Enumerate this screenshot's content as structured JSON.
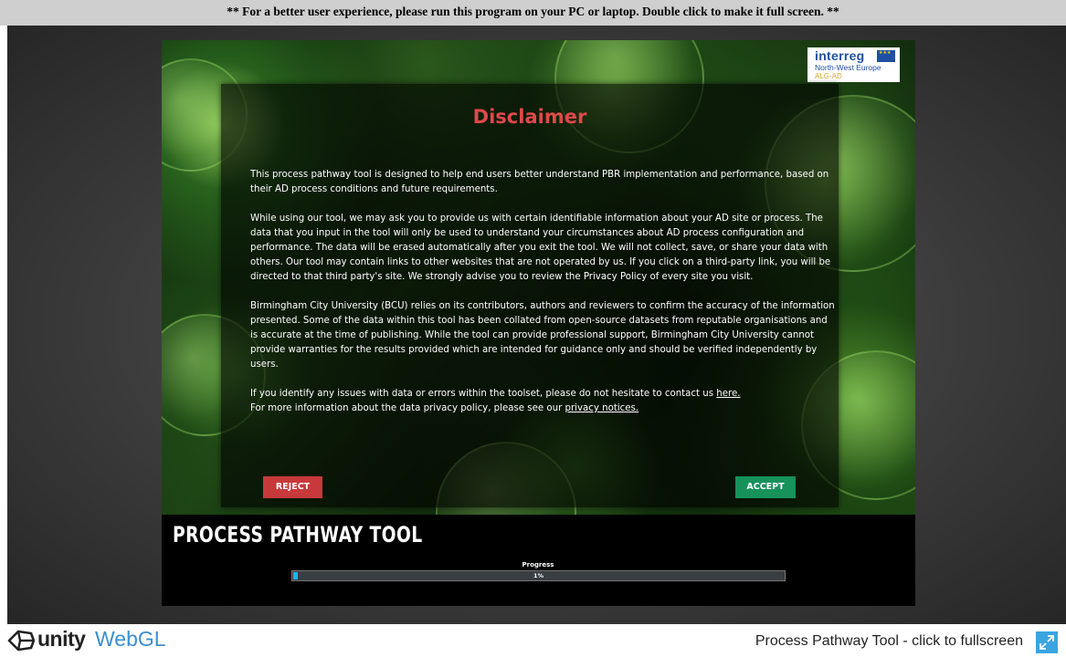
{
  "notice": "** For a better user experience, please run this program on your PC or laptop. Double click to make it full screen. **",
  "logo": {
    "title": "interreg",
    "subtitle": "North-West Europe",
    "project": "ALG-AD",
    "icon": "eu-flag-icon"
  },
  "disclaimer": {
    "title": "Disclaimer",
    "p1": "This process pathway tool is designed to help end users better understand PBR implementation and performance, based on their AD process conditions and future requirements.",
    "p2": "While using our tool, we may ask you to provide us with certain identifiable information about your AD site or process. The data that you input in the tool will only be used to understand your circumstances about AD process configuration and performance. The data will be erased automatically after you exit the tool. We will not collect, save, or share your data with others. Our tool may contain links to other websites that are not operated by us. If you click on a third-party link, you will be directed to that third party's site. We strongly advise you to review the Privacy Policy of every site you visit.",
    "p3": "Birmingham City University (BCU) relies on its contributors, authors and reviewers to confirm the accuracy of the information presented. Some of the data within this tool has been collated from open-source datasets from reputable organisations and is accurate at the time of publishing. While the tool can provide professional support, Birmingham City University cannot provide warranties for the results provided which are intended for guidance only and should be verified independently by users.",
    "contact_prefix": "If you identify any issues with data or errors within the toolset, please do not hesitate to contact us ",
    "contact_link": "here.",
    "privacy_prefix": "For more information about the data privacy policy, please see our ",
    "privacy_link": "privacy notices.",
    "reject_label": "REJECT",
    "accept_label": "ACCEPT"
  },
  "tool": {
    "title": "PROCESS PATHWAY TOOL",
    "progress_label": "Progress",
    "progress_text": "1%",
    "progress_value": 0.01
  },
  "footer": {
    "unity": "unity",
    "webgl": "WebGL",
    "title": "Process Pathway Tool - click to fullscreen",
    "fullscreen_icon": "fullscreen-icon"
  },
  "colors": {
    "title_red": "#e0484a",
    "reject": "#c8393b",
    "accept": "#16925a",
    "progress": "#18b8e6",
    "webgl_blue": "#3b8fd0"
  }
}
